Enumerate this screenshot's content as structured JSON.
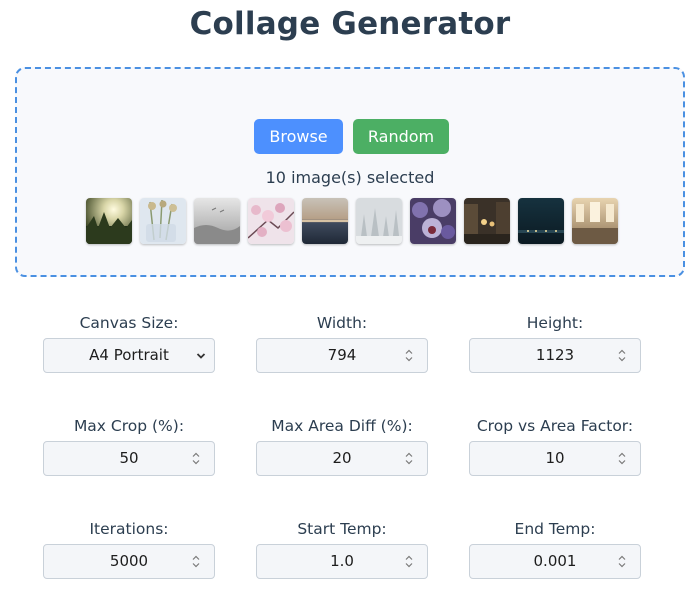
{
  "app": {
    "title": "Collage Generator"
  },
  "upload": {
    "browse_label": "Browse",
    "random_label": "Random",
    "selected_text": "10 image(s) selected",
    "thumbnails": [
      {
        "name": "forest-sunlight"
      },
      {
        "name": "flowers-in-glass"
      },
      {
        "name": "foggy-landscape"
      },
      {
        "name": "cherry-blossoms"
      },
      {
        "name": "sea-sunset"
      },
      {
        "name": "snowy-trees"
      },
      {
        "name": "purple-bokeh"
      },
      {
        "name": "city-street-night"
      },
      {
        "name": "night-skyline"
      },
      {
        "name": "grand-central-hall"
      }
    ]
  },
  "settings": {
    "canvas_size": {
      "label": "Canvas Size:",
      "value": "A4 Portrait"
    },
    "width": {
      "label": "Width:",
      "value": "794"
    },
    "height": {
      "label": "Height:",
      "value": "1123"
    },
    "max_crop": {
      "label": "Max Crop (%):",
      "value": "50"
    },
    "max_area_diff": {
      "label": "Max Area Diff (%):",
      "value": "20"
    },
    "crop_vs_area": {
      "label": "Crop vs Area Factor:",
      "value": "10"
    },
    "iterations": {
      "label": "Iterations:",
      "value": "5000"
    },
    "start_temp": {
      "label": "Start Temp:",
      "value": "1.0"
    },
    "end_temp": {
      "label": "End Temp:",
      "value": "0.001"
    }
  },
  "colors": {
    "title": "#2c3e50",
    "dropzone_border": "#4a90e2",
    "browse_button": "#4d90fe",
    "random_button": "#4caf64"
  },
  "icons": {
    "spinner": "up-down-spinner-icon",
    "select": "chevron-down-icon"
  }
}
